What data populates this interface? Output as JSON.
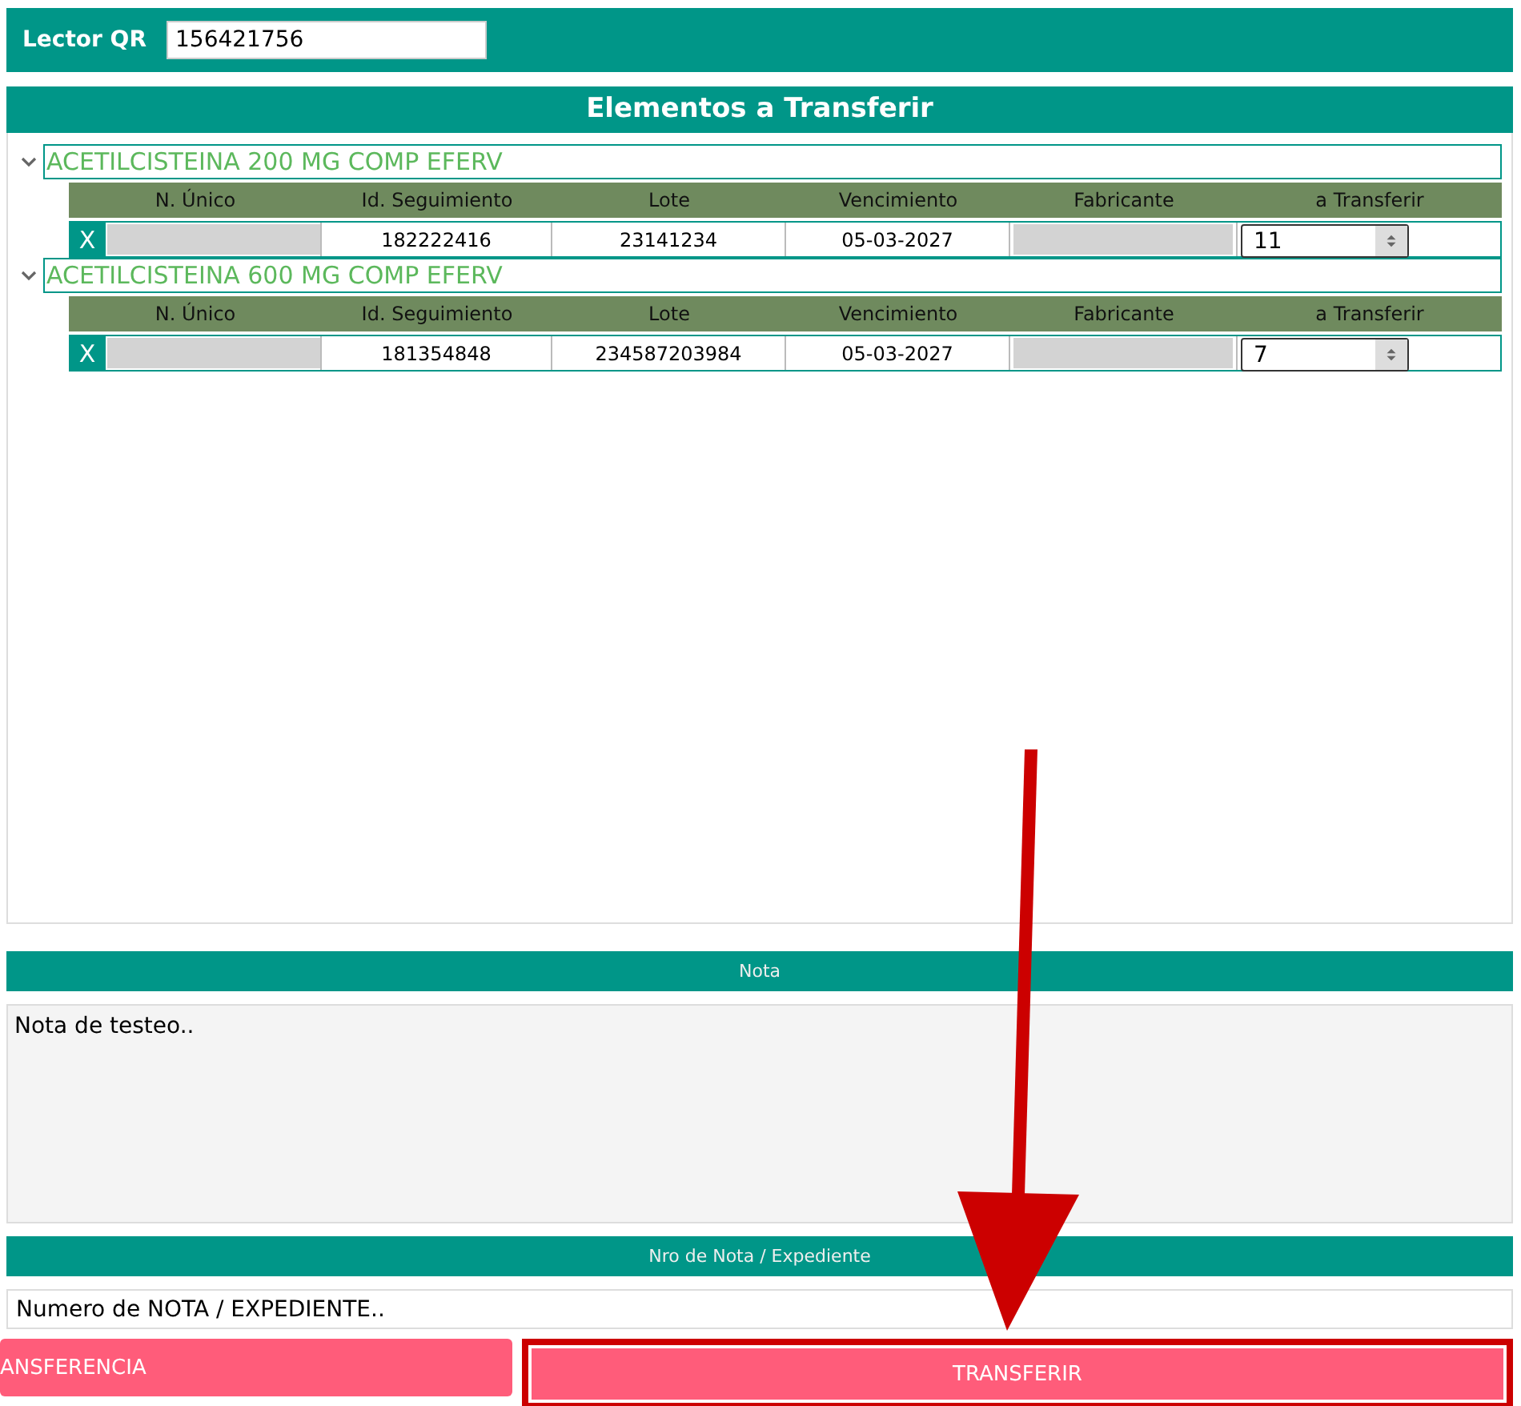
{
  "qr_reader": {
    "label": "Lector QR",
    "value": "156421756"
  },
  "transfer_panel": {
    "title": "Elementos a Transferir",
    "groups": [
      {
        "name": "ACETILCISTEINA 200 MG COMP EFERV",
        "expanded": true,
        "columns": [
          "N. Único",
          "Id. Seguimiento",
          "Lote",
          "Vencimiento",
          "Fabricante",
          "a Transferir"
        ],
        "rows": [
          {
            "remove": "X",
            "tracking_id": "182222416",
            "lot": "23141234",
            "expiry": "05-03-2027",
            "quantity": "11"
          }
        ]
      },
      {
        "name": "ACETILCISTEINA 600 MG COMP EFERV",
        "expanded": true,
        "columns": [
          "N. Único",
          "Id. Seguimiento",
          "Lote",
          "Vencimiento",
          "Fabricante",
          "a Transferir"
        ],
        "rows": [
          {
            "remove": "X",
            "tracking_id": "181354848",
            "lot": "234587203984",
            "expiry": "05-03-2027",
            "quantity": "7"
          }
        ]
      }
    ]
  },
  "note": {
    "title": "Nota",
    "value": "Nota de testeo.."
  },
  "file_number": {
    "title": "Nro de Nota / Expediente",
    "value": "Numero de NOTA / EXPEDIENTE.."
  },
  "buttons": [
    {
      "label": "ANSFERENCIA",
      "highlighted": false
    },
    {
      "label": "TRANSFERIR",
      "highlighted": true
    }
  ]
}
